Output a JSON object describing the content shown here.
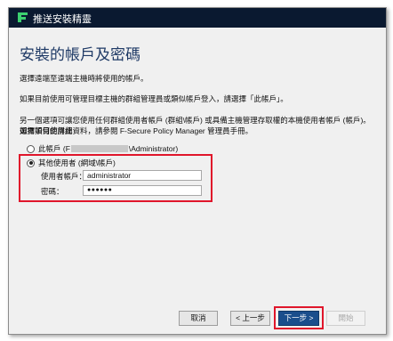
{
  "window": {
    "title": "推送安裝精靈"
  },
  "page": {
    "heading": "安裝的帳戶及密碼",
    "para1": "選擇遠端至遠端主機時將使用的帳戶。",
    "para2": "如果目前使用可管理目標主機的群組管理員或類似帳戶登入，請選擇「此帳戶」。",
    "para3_line1": "另一個選項可讓您使用任何群組使用者帳戶 (群組\\帳戶) 或具備主機管理存取權的本機使用者帳戶 (帳戶)。如需如何使用此",
    "para3_line2": "選擇項目的詳細資料，請參閱 F-Secure Policy Manager 管理員手冊。"
  },
  "options": {
    "this_account_prefix": "此帳戶 (F",
    "this_account_suffix": "\\Administrator)",
    "other_user": "其他使用者 (網域\\帳戶)"
  },
  "fields": {
    "username_label": "使用者帳戶：",
    "username_value": "administrator",
    "password_label": "密碼：",
    "password_value": "●●●●●●"
  },
  "buttons": {
    "cancel": "取消",
    "back": "< 上一步",
    "next": "下一步 >",
    "start": "開始"
  },
  "colors": {
    "titlebar": "#0a1930",
    "accent_red": "#e0162b",
    "primary_button": "#1a4e8c"
  }
}
